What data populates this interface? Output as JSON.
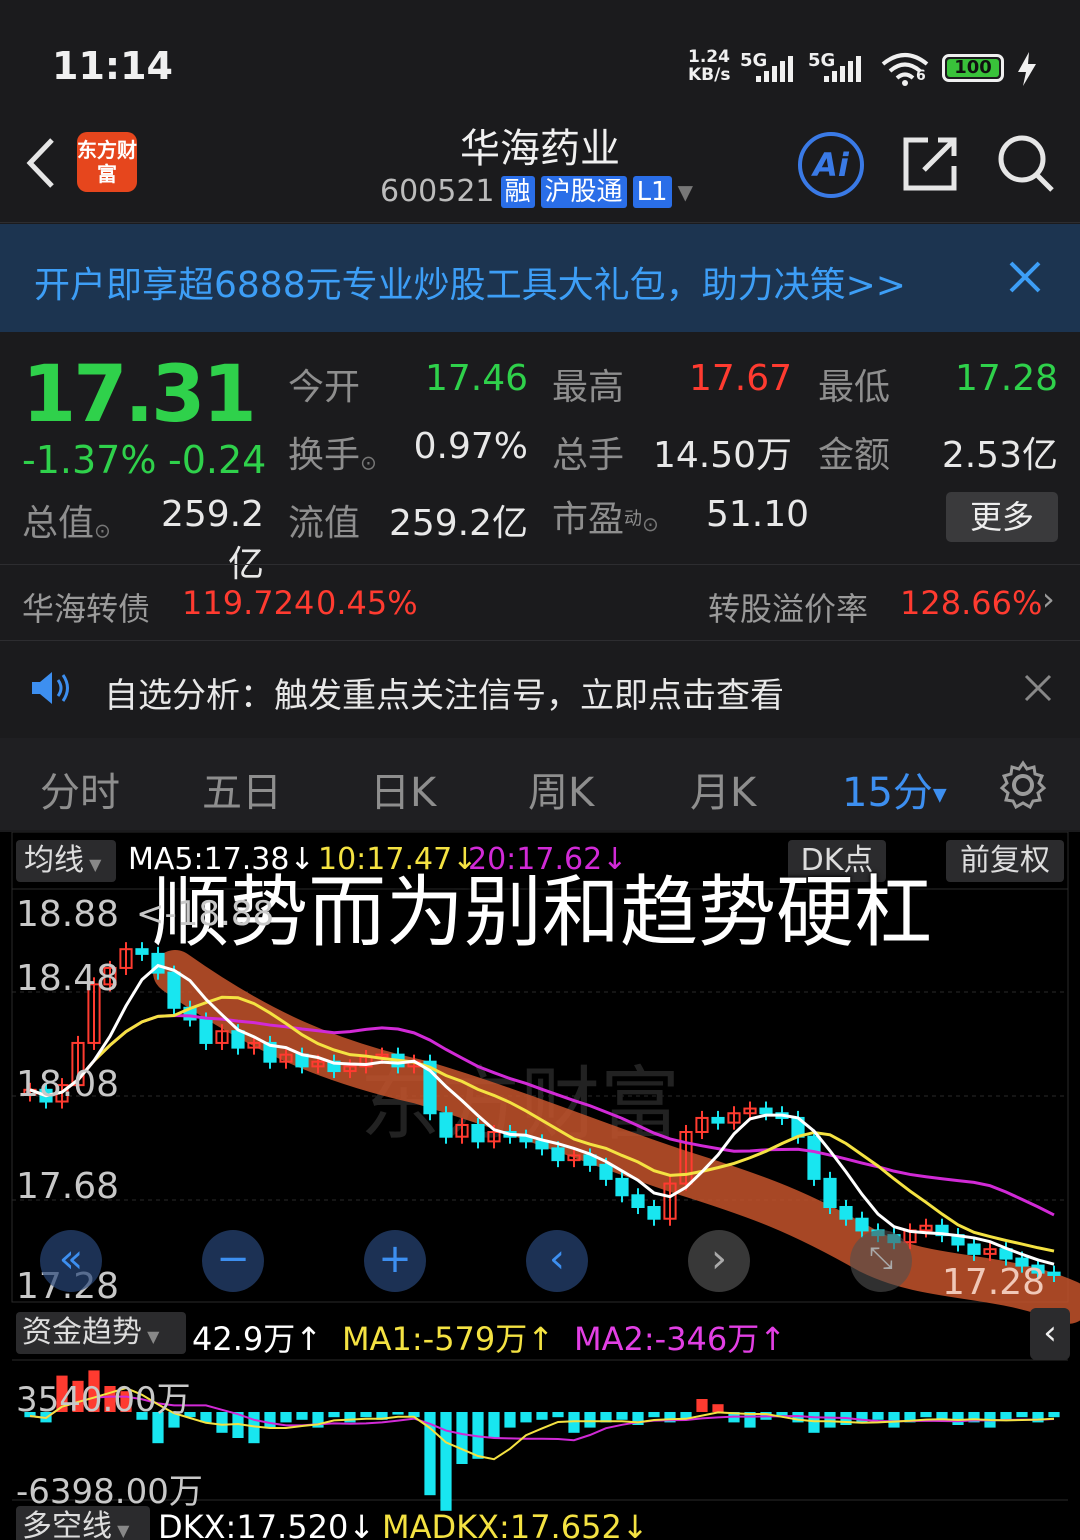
{
  "status_bar": {
    "time": "11:14",
    "net_speed_value": "1.24",
    "net_speed_unit": "KB/s",
    "signal1": "5G",
    "signal2": "5G",
    "wifi_badge": "6",
    "battery": "100"
  },
  "header": {
    "title": "华海药业",
    "code": "600521",
    "tags": [
      "融",
      "沪股通",
      "L1"
    ],
    "logo_text": "东方财富",
    "ai_label": "Ai"
  },
  "banner": {
    "text": "开户即享超6888元专业炒股工具大礼包，助力决策>>"
  },
  "quote": {
    "price": "17.31",
    "change_pct": "-1.37%",
    "change": "-0.24",
    "open_label": "今开",
    "open": "17.46",
    "high_label": "最高",
    "high": "17.67",
    "low_label": "最低",
    "low": "17.28",
    "turnover_label": "换手",
    "turnover": "0.97%",
    "volume_label": "总手",
    "volume": "14.50万",
    "amount_label": "金额",
    "amount": "2.53亿",
    "mktcap_label": "总值",
    "mktcap": "259.2亿",
    "float_label": "流值",
    "float": "259.2亿",
    "pe_label": "市盈",
    "pe_sup": "动",
    "pe": "51.10",
    "more": "更多"
  },
  "bond": {
    "name": "华海转债",
    "price": "119.724",
    "change_pct": "0.45%",
    "premium_label": "转股溢价率",
    "premium": "128.66%"
  },
  "notice": {
    "text": "自选分析：触发重点关注信号，立即点击查看"
  },
  "tabs": [
    "分时",
    "五日",
    "日K",
    "周K",
    "月K",
    "15分"
  ],
  "active_tab": "15分",
  "chart": {
    "ma_toggle": "均线",
    "ma5": "MA5:17.38↓",
    "ma10": "10:17.47↓",
    "ma20": "20:17.62↓",
    "dk_point": "DK点",
    "adjust": "前复权",
    "overlay_title": "顺势而为别和趋势硬杠",
    "y_labels": [
      "18.88",
      "18.48",
      "18.08",
      "17.68",
      "17.28"
    ],
    "high_marker": "<-18.88",
    "last_price_marker": "17.28",
    "watermark": "东方财富",
    "colors": {
      "up": "#ff3b30",
      "down": "#18e6f0",
      "ma5": "#ffffff",
      "ma10": "#f4e242",
      "ma20": "#d12ad6",
      "trend": "#c4532b"
    }
  },
  "indicator": {
    "name": "资金趋势",
    "value": "42.9万↑",
    "ma1": "MA1:-579万↑",
    "ma2": "MA2:-346万↑",
    "y_top": "3540.00万",
    "y_bottom": "-6398.00万"
  },
  "indicator2": {
    "name": "多空线",
    "dkx": "DKX:17.520↓",
    "madkx": "MADKX:17.652↓"
  }
}
